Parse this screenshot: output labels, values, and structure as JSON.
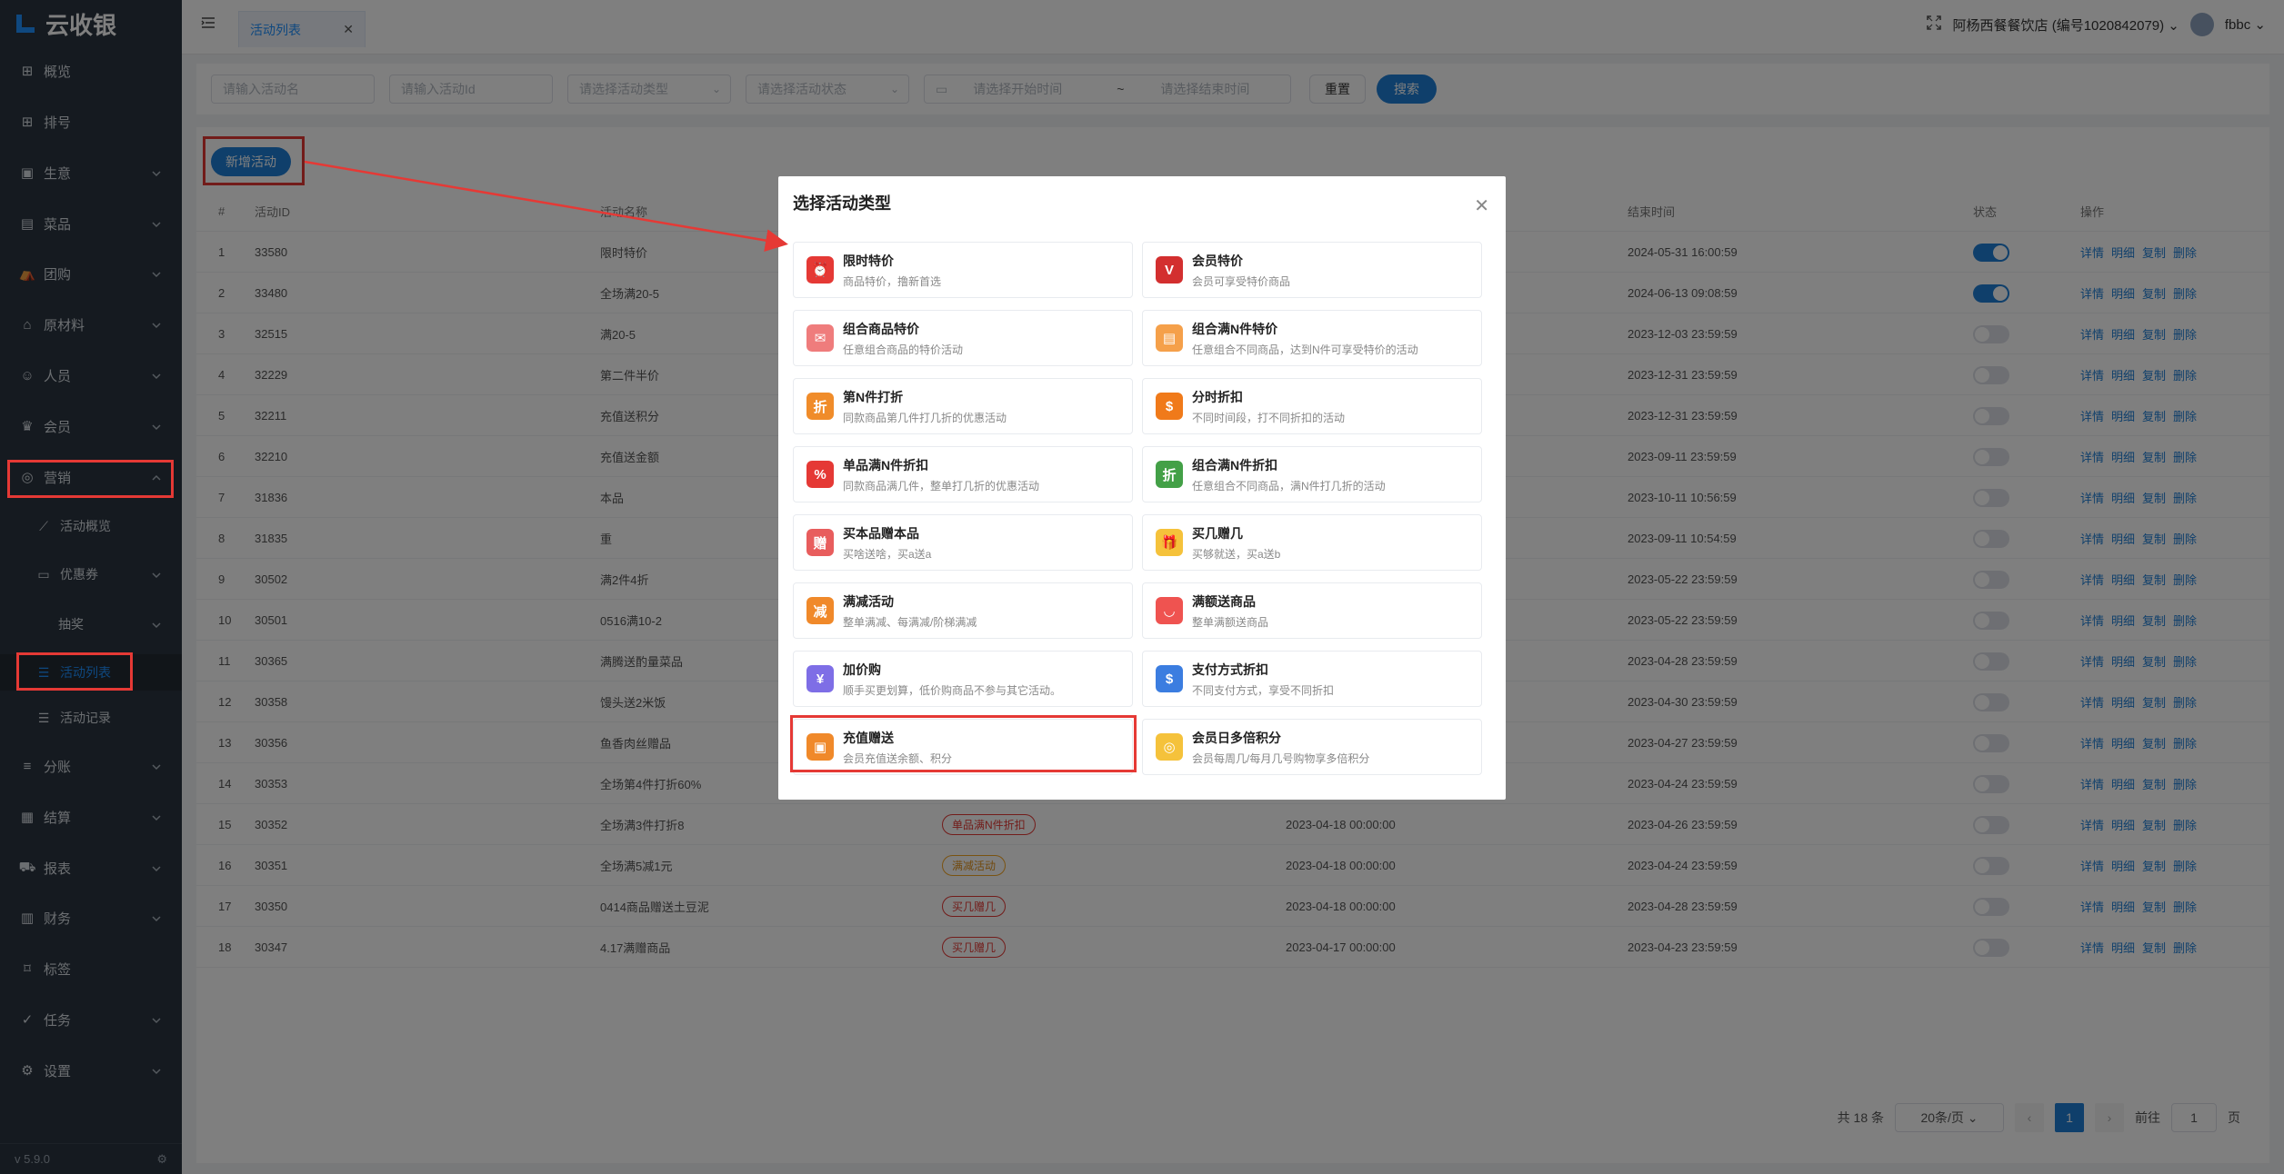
{
  "app": {
    "brand": "云收银",
    "version": "v 5.9.0"
  },
  "sidebar": {
    "items": [
      {
        "label": "概览",
        "icon": "grid-icon"
      },
      {
        "label": "排号",
        "icon": "grid-icon"
      },
      {
        "label": "生意",
        "icon": "receipt-icon"
      },
      {
        "label": "菜品",
        "icon": "menu-icon"
      },
      {
        "label": "团购",
        "icon": "tent-icon"
      },
      {
        "label": "原材料",
        "icon": "building-icon"
      },
      {
        "label": "人员",
        "icon": "user-icon"
      },
      {
        "label": "会员",
        "icon": "crown-icon"
      },
      {
        "label": "营销",
        "icon": "megaphone-icon"
      },
      {
        "label": "活动概览",
        "icon": "chart-icon"
      },
      {
        "label": "优惠券",
        "icon": "ticket-icon"
      },
      {
        "label": "抽奖",
        "icon": ""
      },
      {
        "label": "活动列表",
        "icon": "list-icon"
      },
      {
        "label": "活动记录",
        "icon": "list-icon"
      },
      {
        "label": "分账",
        "icon": "database-icon"
      },
      {
        "label": "结算",
        "icon": "calculator-icon"
      },
      {
        "label": "报表",
        "icon": "cart-icon"
      },
      {
        "label": "财务",
        "icon": "wallet-icon"
      },
      {
        "label": "标签",
        "icon": "tag-icon"
      },
      {
        "label": "任务",
        "icon": "check-icon"
      },
      {
        "label": "设置",
        "icon": "gear-icon"
      }
    ]
  },
  "header": {
    "tab": "活动列表",
    "store": "阿杨西餐餐饮店 (编号1020842079)",
    "user": "fbbc"
  },
  "filter": {
    "name_placeholder": "请输入活动名",
    "id_placeholder": "请输入活动Id",
    "type_placeholder": "请选择活动类型",
    "status_placeholder": "请选择活动状态",
    "start_placeholder": "请选择开始时间",
    "range_sep": "~",
    "end_placeholder": "请选择结束时间",
    "reset": "重置",
    "search": "搜索"
  },
  "main": {
    "add_button": "新增活动",
    "columns": {
      "no": "#",
      "id": "活动ID",
      "name": "活动名称",
      "end": "结束时间",
      "status": "状态",
      "ops": "操作"
    },
    "ops": {
      "detail": "详情",
      "breakdown": "明细",
      "copy": "复制",
      "delete": "删除"
    },
    "rows": [
      {
        "no": "1",
        "id": "33580",
        "name": "限时特价",
        "type": "",
        "start": "",
        "end": "2024-05-31 16:00:59",
        "on": true
      },
      {
        "no": "2",
        "id": "33480",
        "name": "全场满20-5",
        "type": "",
        "start": "",
        "end": "2024-06-13 09:08:59",
        "on": true
      },
      {
        "no": "3",
        "id": "32515",
        "name": "满20-5",
        "type": "",
        "start": "",
        "end": "2023-12-03 23:59:59",
        "on": false
      },
      {
        "no": "4",
        "id": "32229",
        "name": "第二件半价",
        "type": "",
        "start": "",
        "end": "2023-12-31 23:59:59",
        "on": false
      },
      {
        "no": "5",
        "id": "32211",
        "name": "充值送积分",
        "type": "",
        "start": "",
        "end": "2023-12-31 23:59:59",
        "on": false
      },
      {
        "no": "6",
        "id": "32210",
        "name": "充值送金额",
        "type": "",
        "start": "",
        "end": "2023-09-11 23:59:59",
        "on": false
      },
      {
        "no": "7",
        "id": "31836",
        "name": "本品",
        "type": "",
        "start": "",
        "end": "2023-10-11 10:56:59",
        "on": false
      },
      {
        "no": "8",
        "id": "31835",
        "name": "重",
        "type": "",
        "start": "",
        "end": "2023-09-11 10:54:59",
        "on": false
      },
      {
        "no": "9",
        "id": "30502",
        "name": "满2件4折",
        "type": "",
        "start": "",
        "end": "2023-05-22 23:59:59",
        "on": false
      },
      {
        "no": "10",
        "id": "30501",
        "name": "0516满10-2",
        "type": "",
        "start": "",
        "end": "2023-05-22 23:59:59",
        "on": false
      },
      {
        "no": "11",
        "id": "30365",
        "name": "满腾送酌量菜品",
        "type": "",
        "start": "",
        "end": "2023-04-28 23:59:59",
        "on": false
      },
      {
        "no": "12",
        "id": "30358",
        "name": "馒头送2米饭",
        "type": "",
        "start": "",
        "end": "2023-04-30 23:59:59",
        "on": false
      },
      {
        "no": "13",
        "id": "30356",
        "name": "鱼香肉丝赠品",
        "type": "",
        "start": "",
        "end": "2023-04-27 23:59:59",
        "on": false
      },
      {
        "no": "14",
        "id": "30353",
        "name": "全场第4件打折60%",
        "type": "",
        "start": "",
        "end": "2023-04-24 23:59:59",
        "on": false
      },
      {
        "no": "15",
        "id": "30352",
        "name": "全场满3件打折8",
        "type": "单品满N件折扣",
        "tag": "red",
        "start": "2023-04-18 00:00:00",
        "end": "2023-04-26 23:59:59",
        "on": false
      },
      {
        "no": "16",
        "id": "30351",
        "name": "全场满5减1元",
        "type": "满减活动",
        "tag": "orange",
        "start": "2023-04-18 00:00:00",
        "end": "2023-04-24 23:59:59",
        "on": false
      },
      {
        "no": "17",
        "id": "30350",
        "name": "0414商品赠送土豆泥",
        "type": "买几赠几",
        "tag": "red",
        "start": "2023-04-18 00:00:00",
        "end": "2023-04-28 23:59:59",
        "on": false
      },
      {
        "no": "18",
        "id": "30347",
        "name": "4.17满赠商品",
        "type": "买几赠几",
        "tag": "red",
        "start": "2023-04-17 00:00:00",
        "end": "2023-04-23 23:59:59",
        "on": false
      }
    ]
  },
  "pager": {
    "total": "共 18 条",
    "size": "20条/页",
    "current": "1",
    "goto": "前往",
    "goto_value": "1",
    "suffix": "页"
  },
  "modal": {
    "title": "选择活动类型",
    "options": [
      {
        "title": "限时特价",
        "desc": "商品特价，撸新首选",
        "color": "#e53935",
        "glyph": "⏰",
        "icon": "clock-icon"
      },
      {
        "title": "会员特价",
        "desc": "会员可享受特价商品",
        "color": "#d32f2f",
        "glyph": "V",
        "icon": "vip-icon"
      },
      {
        "title": "组合商品特价",
        "desc": "任意组合商品的特价活动",
        "color": "#ef7c7c",
        "glyph": "✉",
        "icon": "bag-icon"
      },
      {
        "title": "组合满N件特价",
        "desc": "任意组合不同商品，达到N件可享受特价的活动",
        "color": "#f5a04a",
        "glyph": "▤",
        "icon": "sale-icon"
      },
      {
        "title": "第N件打折",
        "desc": "同款商品第几件打几折的优惠活动",
        "color": "#f08c2a",
        "glyph": "折",
        "icon": "discount-icon"
      },
      {
        "title": "分时折扣",
        "desc": "不同时间段，打不同折扣的活动",
        "color": "#f07a1a",
        "glyph": "$",
        "icon": "money-bag-icon"
      },
      {
        "title": "单品满N件折扣",
        "desc": "同款商品满几件，整单打几折的优惠活动",
        "color": "#e53935",
        "glyph": "%",
        "icon": "percent-icon"
      },
      {
        "title": "组合满N件折扣",
        "desc": "任意组合不同商品，满N件打几折的活动",
        "color": "#43a047",
        "glyph": "折",
        "icon": "discount-icon"
      },
      {
        "title": "买本品赠本品",
        "desc": "买啥送啥，买a送a",
        "color": "#e85d5d",
        "glyph": "赠",
        "icon": "gift-tag-icon"
      },
      {
        "title": "买几赠几",
        "desc": "买够就送，买a送b",
        "color": "#f5c23b",
        "glyph": "🎁",
        "icon": "gift-icon"
      },
      {
        "title": "满减活动",
        "desc": "整单满减、每满减/阶梯满减",
        "color": "#f0892a",
        "glyph": "减",
        "icon": "minus-icon"
      },
      {
        "title": "满额送商品",
        "desc": "整单满额送商品",
        "color": "#ef5350",
        "glyph": "◡",
        "icon": "smile-bag-icon"
      },
      {
        "title": "加价购",
        "desc": "顺手买更划算，低价购商品不参与其它活动。",
        "color": "#7e6ee6",
        "glyph": "¥",
        "icon": "yen-plus-icon"
      },
      {
        "title": "支付方式折扣",
        "desc": "不同支付方式，享受不同折扣",
        "color": "#3b7de0",
        "glyph": "$",
        "icon": "wallet-icon"
      },
      {
        "title": "充值赠送",
        "desc": "会员充值送余额、积分",
        "color": "#f0892a",
        "glyph": "▣",
        "icon": "recharge-icon"
      },
      {
        "title": "会员日多倍积分",
        "desc": "会员每周几/每月几号购物享多倍积分",
        "color": "#f5c23b",
        "glyph": "◎",
        "icon": "coin-icon"
      }
    ]
  },
  "colors": {
    "primary": "#1e7fd6",
    "highlight": "#e53935",
    "sidebar_bg": "#2b3540"
  }
}
